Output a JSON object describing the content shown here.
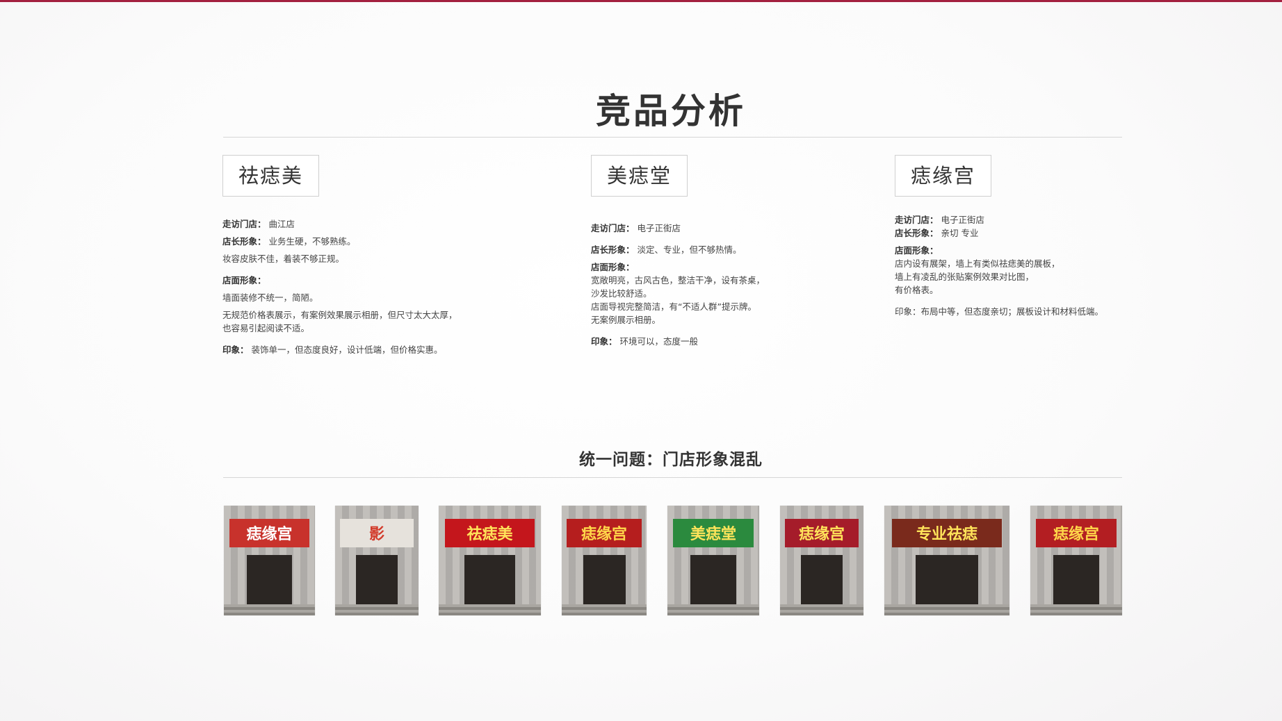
{
  "title": "竞品分析",
  "competitors": [
    {
      "name": "祛痣美",
      "visit_label": "走访门店：",
      "visit_value": "曲江店",
      "manager_label": "店长形象：",
      "manager_lines": [
        "业务生硬，不够熟练。",
        "妆容皮肤不佳，着装不够正规。"
      ],
      "store_label": "店面形象：",
      "store_lines": [
        "墙面装修不统一，简陋。",
        "无规范价格表展示，有案例效果展示相册，但尺寸太大太厚，",
        "也容易引起阅读不适。"
      ],
      "impression_label": "印象：",
      "impression_value": "装饰单一，但态度良好，设计低端，但价格实惠。"
    },
    {
      "name": "美痣堂",
      "visit_label": "走访门店：",
      "visit_value": "电子正街店",
      "manager_label": "店长形象：",
      "manager_lines": [
        "淡定、专业，但不够热情。"
      ],
      "store_label": "店面形象：",
      "store_lines": [
        "宽敞明亮，古风古色，整洁干净，设有茶桌，",
        "沙发比较舒适。",
        "店面导视完整简洁，有“不适人群”提示牌。",
        "无案例展示相册。"
      ],
      "impression_label": "印象：",
      "impression_value": "环境可以，态度一般"
    },
    {
      "name": "痣缘宫",
      "visit_label": "走访门店：",
      "visit_value": "电子正街店",
      "manager_label": "店长形象：",
      "manager_lines": [
        "亲切 专业"
      ],
      "store_label": "店面形象：",
      "store_lines": [
        "店内设有展架，墙上有类似祛痣美的展板，",
        "墙上有凌乱的张贴案例效果对比图，",
        "有价格表。"
      ],
      "impression_label": "印象：",
      "impression_value": "布局中等，但态度亲切；展板设计和材料低端。"
    }
  ],
  "summary": "统一问题：门店形象混乱",
  "photos": [
    {
      "sign_text": "痣缘宫",
      "sign_bg": "#c8322c",
      "sign_fg": "#ffffff"
    },
    {
      "sign_text": "影",
      "sign_bg": "#e6e2dc",
      "sign_fg": "#d23a2a"
    },
    {
      "sign_text": "祛痣美",
      "sign_bg": "#c4161c",
      "sign_fg": "#ffe45a"
    },
    {
      "sign_text": "痣缘宫",
      "sign_bg": "#b51e1e",
      "sign_fg": "#ffd84a"
    },
    {
      "sign_text": "美痣堂",
      "sign_bg": "#2b8a3e",
      "sign_fg": "#ffe45a"
    },
    {
      "sign_text": "痣缘宫",
      "sign_bg": "#a51c2a",
      "sign_fg": "#ffe45a"
    },
    {
      "sign_text": "专业祛痣",
      "sign_bg": "#7a2a1c",
      "sign_fg": "#ffe45a"
    },
    {
      "sign_text": "痣缘宫",
      "sign_bg": "#b31e22",
      "sign_fg": "#ffd84a"
    }
  ],
  "colors": {
    "accent": "#a3203f"
  }
}
